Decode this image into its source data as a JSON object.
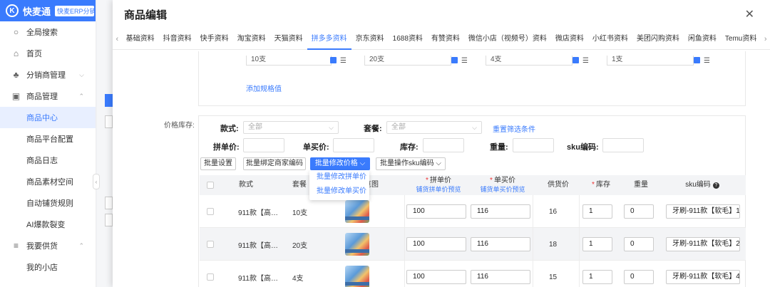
{
  "app": {
    "brand": "快麦通",
    "edition_tag": "快麦ERP分销版-供"
  },
  "sidebar": {
    "search": "全局搜索",
    "items": [
      {
        "label": "首页",
        "icon": "home-icon"
      },
      {
        "label": "分销商管理",
        "icon": "org-icon",
        "chevron": "⌵"
      },
      {
        "label": "商品管理",
        "icon": "box-icon",
        "chevron": "⌃"
      }
    ],
    "sub_items": [
      {
        "label": "商品中心",
        "active": true
      },
      {
        "label": "商品平台配置"
      },
      {
        "label": "商品日志"
      },
      {
        "label": "商品素材空间"
      },
      {
        "label": "自动铺货规则"
      },
      {
        "label": "AI爆款裂变"
      }
    ],
    "supply": {
      "label": "我要供货",
      "icon": "stack-icon",
      "chevron": "⌃"
    },
    "supply_sub": [
      {
        "label": "我的小店"
      }
    ]
  },
  "modal": {
    "title": "商品编辑",
    "close": "✕",
    "tabs": [
      "基础资料",
      "抖音资料",
      "快手资料",
      "淘宝资料",
      "天猫资料",
      "拼多多资料",
      "京东资料",
      "1688资料",
      "有赞资料",
      "微信小店（视频号）资料",
      "微店资料",
      "小红书资料",
      "美团闪购资料",
      "闲鱼资料",
      "Temu资料"
    ],
    "active_tab": "拼多多资料"
  },
  "spec": {
    "values": [
      "10支",
      "20支",
      "4支",
      "1支"
    ],
    "add_label": "添加规格值"
  },
  "price_stock": {
    "section_label": "价格库存:",
    "filters": {
      "style_label": "款式:",
      "style_value": "全部",
      "package_label": "套餐:",
      "package_value": "全部",
      "reset": "重置筛选条件",
      "group_price_label": "拼单价:",
      "single_price_label": "单买价:",
      "stock_label": "库存:",
      "weight_label": "重量:",
      "sku_label": "sku编码:"
    },
    "buttons": {
      "batch_set": "批量设置",
      "batch_bind": "批量绑定商家编码",
      "batch_price": "批量修改价格 ⌵",
      "batch_sku": "批量操作sku编码 ⌵"
    },
    "dropdown": [
      "批量修改拼单价",
      "批量修改单买价"
    ],
    "columns": {
      "style": "款式",
      "package": "套餐",
      "preview": "览图",
      "group_price": "拼单价",
      "group_price_sub": "铺货拼单价预览",
      "single_price": "单买价",
      "single_price_sub": "铺货单买价预览",
      "supply_price": "供货价",
      "stock": "库存",
      "weight": "重量",
      "sku": "sku编码",
      "required_mark": "*",
      "help": "?"
    },
    "rows": [
      {
        "style": "911款【高…",
        "package": "10支",
        "group_price": "100",
        "single_price": "116",
        "supply_price": "16",
        "stock": "1",
        "weight": "0",
        "sku": "牙刷-911款【软毛】1"
      },
      {
        "style": "911款【高…",
        "package": "20支",
        "group_price": "100",
        "single_price": "116",
        "supply_price": "18",
        "stock": "1",
        "weight": "0",
        "sku": "牙刷-911款【软毛】2"
      },
      {
        "style": "911款【高…",
        "package": "4支",
        "group_price": "100",
        "single_price": "116",
        "supply_price": "15",
        "stock": "1",
        "weight": "0",
        "sku": "牙刷-911款【软毛】4"
      }
    ]
  }
}
